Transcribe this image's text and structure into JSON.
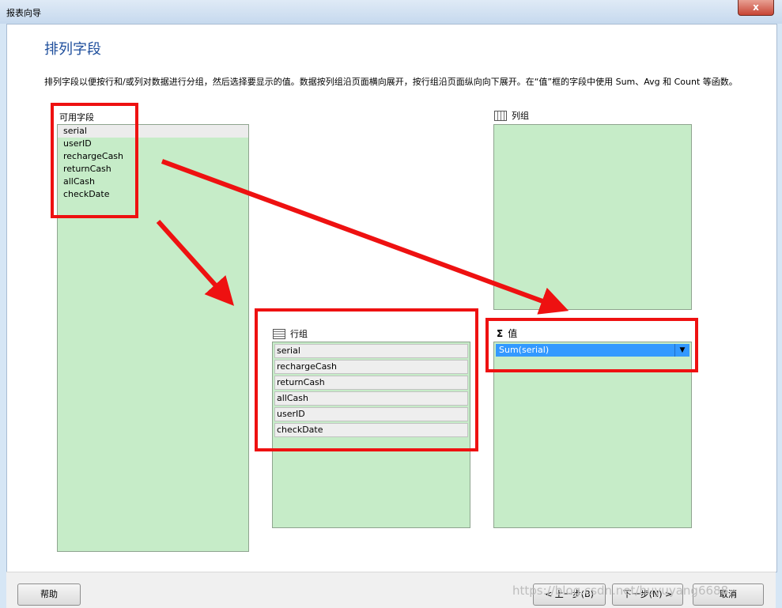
{
  "window": {
    "title": "报表向导",
    "close_glyph": "x"
  },
  "page": {
    "heading": "排列字段",
    "description": "排列字段以便按行和/或列对数据进行分组，然后选择要显示的值。数据按列组沿页面横向展开，按行组沿页面纵向向下展开。在“值”框的字段中使用 Sum、Avg 和 Count 等函数。"
  },
  "available": {
    "label": "可用字段",
    "fields": [
      "serial",
      "userID",
      "rechargeCash",
      "returnCash",
      "allCash",
      "checkDate"
    ]
  },
  "column_groups": {
    "label": "列组"
  },
  "row_groups": {
    "label": "行组",
    "items": [
      "serial",
      "rechargeCash",
      "returnCash",
      "allCash",
      "userID",
      "checkDate"
    ]
  },
  "values": {
    "label": "值",
    "sigma": "Σ",
    "items": [
      "Sum(serial)"
    ]
  },
  "buttons": {
    "help": "帮助",
    "back": "< 上一步(B)",
    "next": "下一步(N) >",
    "cancel": "取消"
  },
  "watermark": "https://blog.csdn.net/huyuyang6688",
  "colors": {
    "zone_fill": "#c6ecc8",
    "heading": "#1e4e9c",
    "annotation_red": "#ee1111",
    "selection": "#3399ff"
  }
}
